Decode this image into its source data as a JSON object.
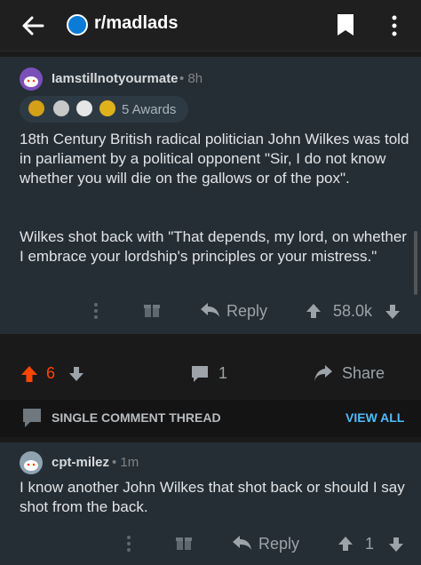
{
  "header": {
    "subreddit": "r/madlads",
    "icons": [
      "back-arrow-icon",
      "subreddit-icon",
      "bookmark-icon",
      "kebab-icon"
    ]
  },
  "comment1": {
    "username": "Iamstillnotyourmate",
    "age": "• 8h",
    "awards_label": "5 Awards",
    "body_p1": "18th Century British radical politician John Wilkes was told in parliament by a political opponent \"Sir, I do not know whether you will die on the gallows or of the pox\".",
    "body_p2": "Wilkes shot back with \"That depends, my lord, on whether I embrace your lordship's principles or your mistress.\"",
    "reply_label": "Reply",
    "score": "58.0k"
  },
  "post_actions": {
    "votes": "6",
    "comments": "1",
    "share_label": "Share"
  },
  "thread_bar": {
    "label": "SINGLE COMMENT THREAD",
    "view_all": "VIEW ALL"
  },
  "comment2": {
    "username": "cpt-milez",
    "age": "• 1m",
    "body": "I know another John Wilkes that shot back or should I say shot from the back.",
    "reply_label": "Reply",
    "score": "1"
  },
  "colors": {
    "background": "#1a1a1b",
    "card": "#252e35",
    "upvote_orange": "#ff4500",
    "link_blue": "#4fbcff"
  }
}
